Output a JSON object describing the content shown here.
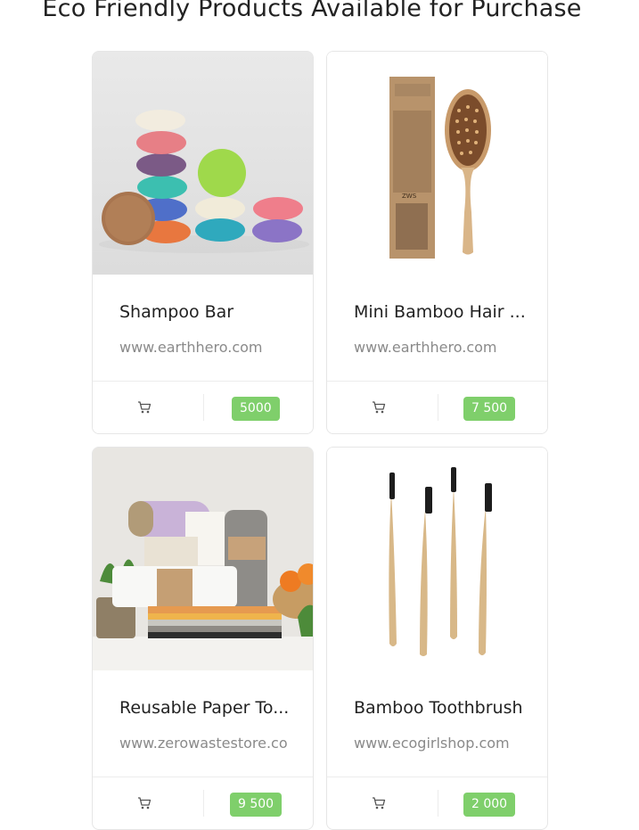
{
  "page_title": "Eco Friendly Products Available for Purchase",
  "products": [
    {
      "name": "Shampoo Bar",
      "url": "www.earthhero.com",
      "price": "5000",
      "cart_icon": "cart-icon"
    },
    {
      "name": "Mini Bamboo Hair ...",
      "url": "www.earthhero.com",
      "price": "7 500",
      "cart_icon": "cart-icon"
    },
    {
      "name": "Reusable Paper To...",
      "url": "www.zerowastestore.com",
      "price": "9 500",
      "cart_icon": "cart-icon"
    },
    {
      "name": "Bamboo Toothbrush",
      "url": "www.ecogirlshop.com",
      "price": "2 000",
      "cart_icon": "cart-icon"
    }
  ],
  "colors": {
    "price_badge": "#7fcf6b",
    "title_text": "#222222",
    "url_text": "#8a8a8a"
  }
}
